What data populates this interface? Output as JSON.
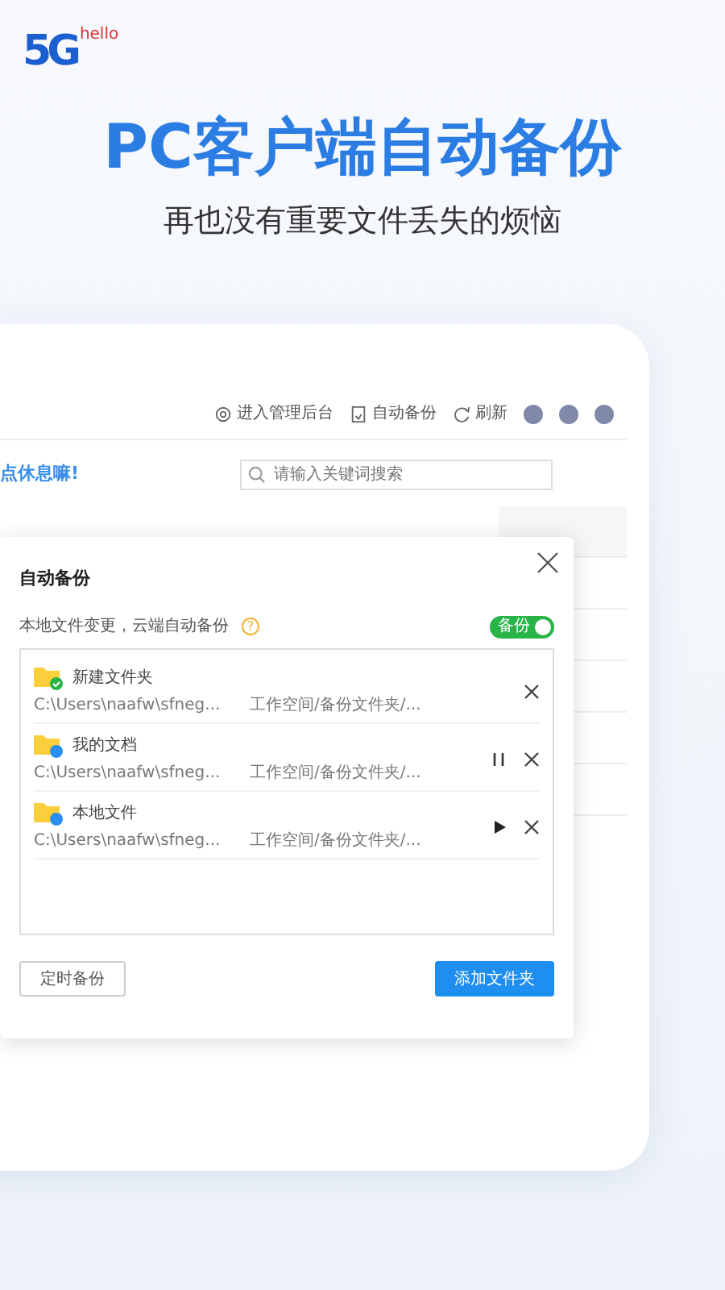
{
  "logo": {
    "text": "5G",
    "badge": "hello"
  },
  "headline": "PC客户端自动备份",
  "subheadline": "再也没有重要文件丢失的烦恼",
  "app": {
    "toolbar": [
      {
        "kind": "gear",
        "label": "进入管理后台"
      },
      {
        "kind": "doc",
        "label": "自动备份"
      },
      {
        "kind": "refresh",
        "label": "刷新"
      }
    ],
    "greeting": "点休息嘛!",
    "search": {
      "placeholder": "请输入关键词搜索"
    }
  },
  "dialog": {
    "title": "自动备份",
    "hint": "本地文件变更，云端自动备份",
    "help": "?",
    "toggle": {
      "label": "备份",
      "on": true
    },
    "folders": [
      {
        "kind": "done",
        "name": "新建文件夹",
        "path": "C:\\Users\\naafw\\sfneg...",
        "target": "工作空间/备份文件夹/..."
      },
      {
        "kind": "running",
        "name": "我的文档",
        "path": "C:\\Users\\naafw\\sfneg...",
        "target": "工作空间/备份文件夹/..."
      },
      {
        "kind": "paused",
        "name": "本地文件",
        "path": "C:\\Users\\naafw\\sfneg...",
        "target": "工作空间/备份文件夹/..."
      }
    ],
    "buttons": [
      {
        "kind": "secondary",
        "label": "定时备份"
      },
      {
        "kind": "primary",
        "label": "添加文件夹"
      }
    ]
  }
}
